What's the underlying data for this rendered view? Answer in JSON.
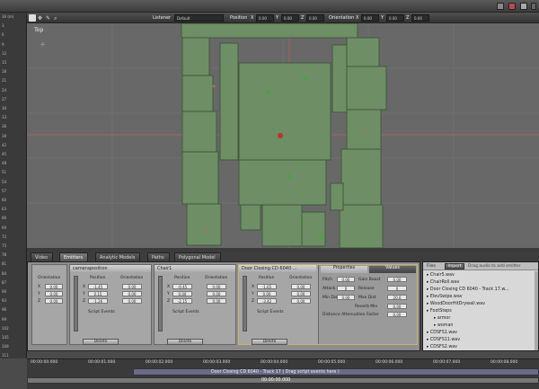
{
  "toolbar": {
    "listener_label": "Listener",
    "listener_value": "Default",
    "position_label": "Position",
    "orientation_label": "Orientation",
    "axis_x": "X",
    "axis_y": "Y",
    "axis_z": "Z",
    "field_value": "0.00"
  },
  "ruler_labels": [
    "30 (m)",
    "3",
    "6",
    "9",
    "12",
    "15",
    "18",
    "21",
    "24",
    "27",
    "30",
    "33",
    "36",
    "39",
    "42",
    "45",
    "48",
    "51",
    "54",
    "57",
    "60",
    "63",
    "66",
    "69",
    "72",
    "75",
    "78",
    "81",
    "84",
    "87",
    "90",
    "93",
    "96",
    "99",
    "102",
    "105",
    "108",
    "111"
  ],
  "viewport": {
    "label": "Top"
  },
  "tabs": [
    {
      "label": "Video"
    },
    {
      "label": "Emitters"
    },
    {
      "label": "Analytic Models"
    },
    {
      "label": "Paths"
    },
    {
      "label": "Polygonal Model"
    }
  ],
  "emitters": [
    {
      "title": "",
      "subtitle": "Orientation",
      "x": "0.00",
      "y": "0.00",
      "z": "0.00",
      "delete": ""
    },
    {
      "title": "cameraposition",
      "pos_x": "-1.45",
      "pos_y": "0.15",
      "pos_z": "-1.26",
      "ori_x": "0.00",
      "ori_y": "0.00",
      "ori_z": "0.00",
      "script": "Script Events",
      "delete": "Delete"
    },
    {
      "title": "Chair1",
      "pos_x": "-0.45",
      "pos_y": "0.00",
      "pos_z": "-2.15",
      "ori_x": "0.00",
      "ori_y": "0.00",
      "ori_z": "0.00",
      "script": "Script Events",
      "delete": "Delete"
    },
    {
      "title": "Door Closing CD 6040 ...",
      "pos_x": "-1.65",
      "pos_y": "0.00",
      "pos_z": "-3.42",
      "ori_x": "0.00",
      "ori_y": "0.00",
      "ori_z": "0.00",
      "script": "Script Events",
      "delete": "Delete"
    }
  ],
  "emitter_labels": {
    "position": "Position",
    "orientation": "Orientation",
    "x": "X",
    "y": "Y",
    "z": "Z"
  },
  "properties": {
    "tab_properties": "Properties",
    "tab_values": "Values",
    "pitch": "Pitch",
    "attack": "Attack",
    "min_dist": "Min Dist",
    "gain_boost": "Gain Boost",
    "release": "Release",
    "max_dist": "Max Dist",
    "reverb_mix": "Reverb Mix",
    "distance_attenuation": "Distance Attenuation Factor",
    "value": "0.00",
    "attack_value": "0",
    "max_value": "20.0"
  },
  "files": {
    "label": "Files",
    "import_btn": "Import",
    "hint": "Drag audio to add emitter",
    "items": [
      "Chair5.wav",
      "ChairRoll.wav",
      "Door Closing CD 6040 - Track 17.w...",
      "ElevSwipe.wav",
      "WoodDoorHitDrywall.wav",
      "FootSteps",
      "armor",
      "woman",
      "CDSFS1.wav",
      "CDSFS11.wav",
      "CDSFS2.wav"
    ]
  },
  "timeline": {
    "times": [
      "00:00:00.000",
      "00:00:01.000",
      "00:00:02.000",
      "00:00:03.000",
      "00:00:04.000",
      "00:00:05.000",
      "00:00:06.000",
      "00:00:07.000",
      "00:00:08.000"
    ],
    "track_label": "Door Closing CD 6040 - Track 17 ( Drag script events here )",
    "current_time": "00:00:00.000"
  },
  "colors": {
    "room_fill": "#6e8e66",
    "accent": "#b83232"
  }
}
